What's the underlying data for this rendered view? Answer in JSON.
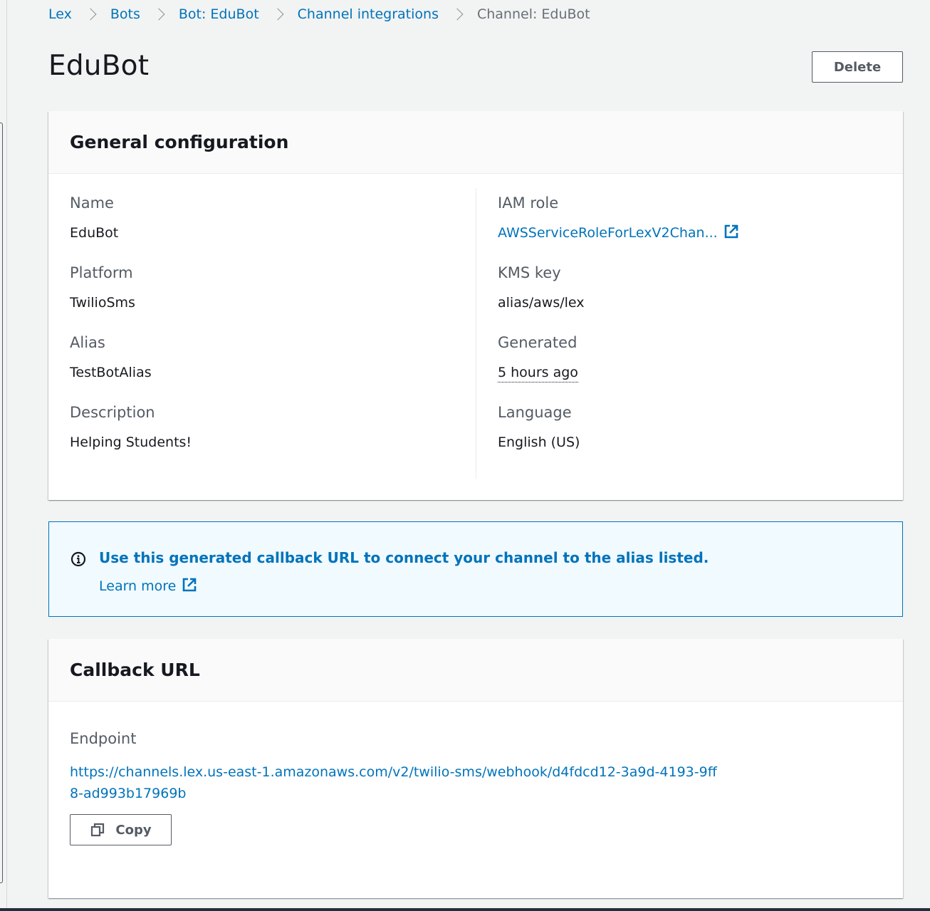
{
  "breadcrumb": {
    "items": [
      {
        "label": "Lex",
        "link": true
      },
      {
        "label": "Bots",
        "link": true
      },
      {
        "label": "Bot: EduBot",
        "link": true
      },
      {
        "label": "Channel integrations",
        "link": true
      },
      {
        "label": "Channel: EduBot",
        "link": false
      }
    ]
  },
  "page": {
    "title": "EduBot",
    "delete_label": "Delete"
  },
  "general": {
    "heading": "General configuration",
    "left": [
      {
        "key": "Name",
        "value": "EduBot"
      },
      {
        "key": "Platform",
        "value": "TwilioSms"
      },
      {
        "key": "Alias",
        "value": "TestBotAlias"
      },
      {
        "key": "Description",
        "value": "Helping Students!"
      }
    ],
    "right": [
      {
        "key": "IAM role",
        "value": "AWSServiceRoleForLexV2Chan..."
      },
      {
        "key": "KMS key",
        "value": "alias/aws/lex"
      },
      {
        "key": "Generated",
        "value": "5 hours ago"
      },
      {
        "key": "Language",
        "value": "English (US)"
      }
    ]
  },
  "alert": {
    "message": "Use this generated callback URL to connect your channel to the alias listed.",
    "learn_more": "Learn more"
  },
  "callback": {
    "heading": "Callback URL",
    "endpoint_label": "Endpoint",
    "endpoint_url": "https://channels.lex.us-east-1.amazonaws.com/v2/twilio-sms/webhook/d4fdcd12-3a9d-4193-9ff8-ad993b17969b",
    "copy_label": "Copy"
  },
  "colors": {
    "link": "#0073bb",
    "background": "#f2f3f3",
    "alert_bg": "#f1faff"
  },
  "icons": [
    "chevron-right-icon",
    "external-link-icon",
    "info-icon",
    "copy-icon"
  ]
}
